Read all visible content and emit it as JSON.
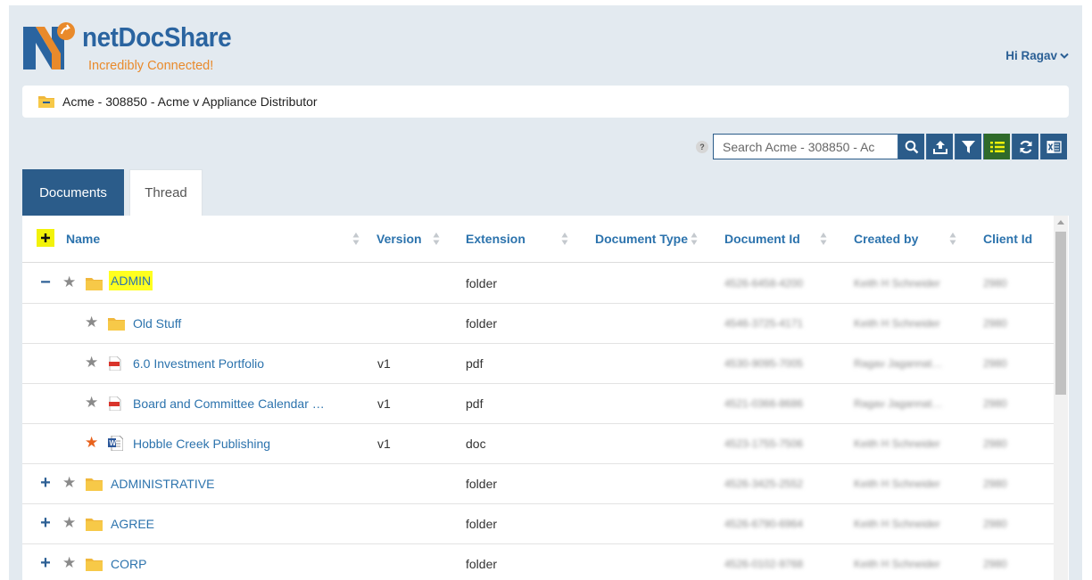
{
  "brand": {
    "name": "netDocShare",
    "tagline": "Incredibly Connected!",
    "logo_letter": "N",
    "colors": {
      "primary": "#2a64a0",
      "accent": "#e98a2b"
    }
  },
  "user": {
    "greeting": "Hi Ragav"
  },
  "breadcrumb": {
    "icon": "folder-icon",
    "text": "Acme - 308850 - Acme v Appliance Distributor"
  },
  "toolbar": {
    "help_label": "?",
    "search_placeholder": "Search Acme - 308850 - Ac",
    "buttons": [
      "search-icon",
      "upload-icon",
      "filter-icon",
      "list-view-icon",
      "refresh-icon",
      "excel-export-icon"
    ],
    "active_button": "list-view-icon"
  },
  "tabs": [
    {
      "label": "Documents",
      "active": true
    },
    {
      "label": "Thread",
      "active": false
    }
  ],
  "table": {
    "columns": [
      "Name",
      "Version",
      "Extension",
      "Document Type",
      "Document Id",
      "Created by",
      "Client Id"
    ],
    "rows": [
      {
        "toggle": "−",
        "starred": false,
        "icon": "folder-icon",
        "name": "ADMIN",
        "highlight": true,
        "version": "",
        "extension": "folder",
        "doc_type": "",
        "doc_id": "4526-6458-4200",
        "created_by": "Keith H Schneider",
        "client_id": "2980",
        "indent": 0
      },
      {
        "toggle": "",
        "starred": false,
        "icon": "folder-icon",
        "name": "Old Stuff",
        "highlight": false,
        "version": "",
        "extension": "folder",
        "doc_type": "",
        "doc_id": "4546-3725-4171",
        "created_by": "Keith H Schneider",
        "client_id": "2980",
        "indent": 1
      },
      {
        "toggle": "",
        "starred": false,
        "icon": "pdf-icon",
        "name": "6.0 Investment Portfolio",
        "highlight": false,
        "version": "v1",
        "extension": "pdf",
        "doc_type": "",
        "doc_id": "4530-9095-7005",
        "created_by": "Ragav Jagannat…",
        "client_id": "2980",
        "indent": 1
      },
      {
        "toggle": "",
        "starred": false,
        "icon": "pdf-icon",
        "name": "Board and Committee Calendar …",
        "highlight": false,
        "version": "v1",
        "extension": "pdf",
        "doc_type": "",
        "doc_id": "4521-0366-8686",
        "created_by": "Ragav Jagannat…",
        "client_id": "2980",
        "indent": 1
      },
      {
        "toggle": "",
        "starred": true,
        "icon": "word-doc-icon",
        "name": "Hobble Creek Publishing",
        "highlight": false,
        "version": "v1",
        "extension": "doc",
        "doc_type": "",
        "doc_id": "4523-1755-7506",
        "created_by": "Keith H Schneider",
        "client_id": "2980",
        "indent": 1
      },
      {
        "toggle": "+",
        "starred": false,
        "icon": "folder-icon",
        "name": "ADMINISTRATIVE",
        "highlight": false,
        "version": "",
        "extension": "folder",
        "doc_type": "",
        "doc_id": "4526-3425-2552",
        "created_by": "Keith H Schneider",
        "client_id": "2980",
        "indent": 0
      },
      {
        "toggle": "+",
        "starred": false,
        "icon": "folder-icon",
        "name": "AGREE",
        "highlight": false,
        "version": "",
        "extension": "folder",
        "doc_type": "",
        "doc_id": "4526-6790-6964",
        "created_by": "Keith H Schneider",
        "client_id": "2980",
        "indent": 0
      },
      {
        "toggle": "+",
        "starred": false,
        "icon": "folder-icon",
        "name": "CORP",
        "highlight": false,
        "version": "",
        "extension": "folder",
        "doc_type": "",
        "doc_id": "4526-0102-9768",
        "created_by": "Keith H Schneider",
        "client_id": "2980",
        "indent": 0
      }
    ]
  }
}
